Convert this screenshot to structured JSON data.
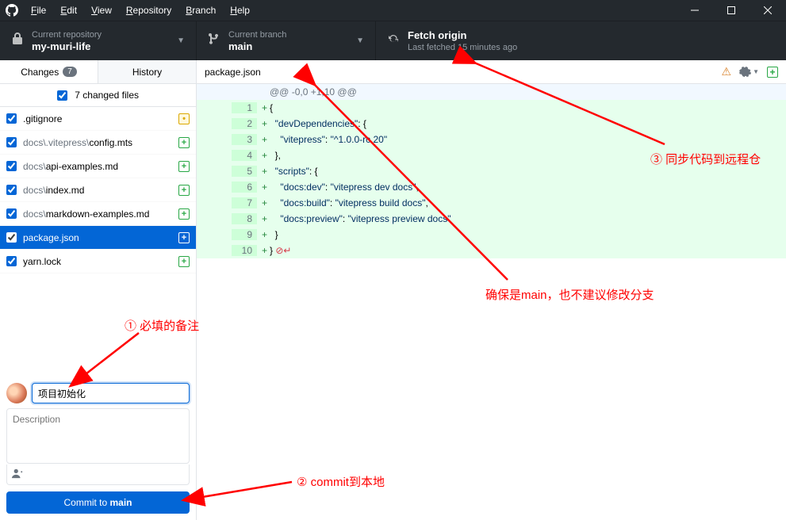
{
  "menu": {
    "file": "File",
    "edit": "Edit",
    "view": "View",
    "repository": "Repository",
    "branch": "Branch",
    "help": "Help"
  },
  "toolbar": {
    "repo_label": "Current repository",
    "repo_value": "my-muri-life",
    "branch_label": "Current branch",
    "branch_value": "main",
    "fetch_label": "Fetch origin",
    "fetch_sub": "Last fetched 15 minutes ago"
  },
  "tabs": {
    "changes": "Changes",
    "changes_count": "7",
    "history": "History"
  },
  "changes_header": "7 changed files",
  "files": [
    {
      "path": "",
      "name": ".gitignore",
      "status": "M"
    },
    {
      "path": "docs\\.vitepress\\",
      "name": "config.mts",
      "status": "A"
    },
    {
      "path": "docs\\",
      "name": "api-examples.md",
      "status": "A"
    },
    {
      "path": "docs\\",
      "name": "index.md",
      "status": "A"
    },
    {
      "path": "docs\\",
      "name": "markdown-examples.md",
      "status": "A"
    },
    {
      "path": "",
      "name": "package.json",
      "status": "A"
    },
    {
      "path": "",
      "name": "yarn.lock",
      "status": "A"
    }
  ],
  "commit": {
    "summary_value": "项目初始化",
    "description_placeholder": "Description",
    "btn_prefix": "Commit to ",
    "btn_branch": "main",
    "coauthor_icon": "A+"
  },
  "diff": {
    "title": "package.json",
    "hunk": "@@ -0,0 +1,10 @@",
    "lines": [
      {
        "n": "1",
        "raw": "+{"
      },
      {
        "n": "2",
        "raw": "+  \"devDependencies\": {"
      },
      {
        "n": "3",
        "raw": "+    \"vitepress\": \"^1.0.0-rc.20\""
      },
      {
        "n": "4",
        "raw": "+  },"
      },
      {
        "n": "5",
        "raw": "+  \"scripts\": {"
      },
      {
        "n": "6",
        "raw": "+    \"docs:dev\": \"vitepress dev docs\","
      },
      {
        "n": "7",
        "raw": "+    \"docs:build\": \"vitepress build docs\","
      },
      {
        "n": "8",
        "raw": "+    \"docs:preview\": \"vitepress preview docs\""
      },
      {
        "n": "9",
        "raw": "+  }"
      },
      {
        "n": "10",
        "raw": "+}"
      }
    ]
  },
  "annotations": {
    "a1": "① 必填的备注",
    "a2": "② commit到本地",
    "a3": "③ 同步代码到远程仓",
    "a4": "确保是main，也不建议修改分支"
  }
}
